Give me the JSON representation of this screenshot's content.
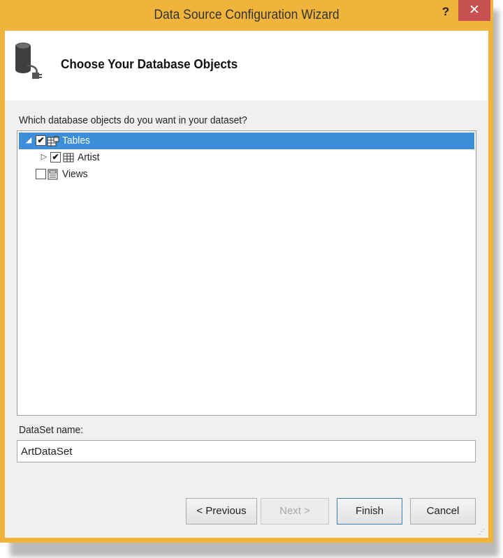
{
  "window": {
    "title": "Data Source Configuration Wizard",
    "help_label": "?",
    "close_label": "✕"
  },
  "header": {
    "title": "Choose Your Database Objects",
    "icon": "database-icon"
  },
  "tree": {
    "prompt": "Which database objects do you want in your dataset?",
    "nodes": [
      {
        "label": "Tables",
        "checked": true,
        "expanded": true,
        "selected": true,
        "icon": "tables-folder-icon",
        "expander": "◢",
        "check_mark": "✔"
      },
      {
        "label": "Artist",
        "checked": true,
        "expanded": false,
        "selected": false,
        "icon": "table-grid-icon",
        "expander": "▷",
        "check_mark": "✔"
      },
      {
        "label": "Views",
        "checked": false,
        "expanded": false,
        "selected": false,
        "icon": "views-icon",
        "expander": "",
        "check_mark": ""
      }
    ]
  },
  "dataset": {
    "label": "DataSet name:",
    "value": "ArtDataSet"
  },
  "buttons": {
    "previous": "< Previous",
    "next": "Next >",
    "finish": "Finish",
    "cancel": "Cancel"
  },
  "colors": {
    "frame": "#f0b43c",
    "close_bg": "#c75050",
    "selection": "#3d8ed9"
  }
}
